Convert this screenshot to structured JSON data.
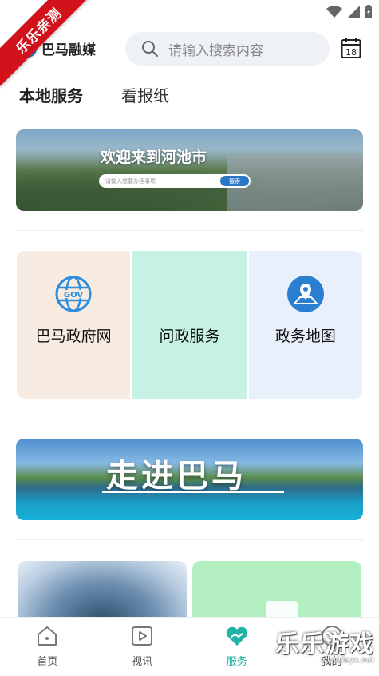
{
  "watermark": {
    "ribbon": "乐乐亲测",
    "logo": "乐乐游戏",
    "url": "www.leyx.net"
  },
  "header": {
    "brand_name": "巴马融媒",
    "search_placeholder": "请输入搜索内容",
    "calendar_day": "18"
  },
  "tabs": [
    {
      "label": "本地服务",
      "active": true
    },
    {
      "label": "看报纸",
      "active": false
    }
  ],
  "banner_welcome": {
    "title": "欢迎来到河池市",
    "search_placeholder": "请输入想要办理事项",
    "search_button": "搜索"
  },
  "services": [
    {
      "label": "巴马政府网",
      "icon": "gov-globe-icon",
      "color": "#f8ebe1"
    },
    {
      "label": "问政服务",
      "icon": "none",
      "color": "#c5f2e4"
    },
    {
      "label": "政务地图",
      "icon": "map-pin-icon",
      "color": "#e8f0fb"
    }
  ],
  "banner_bama": {
    "title": "走进巴马"
  },
  "nav": [
    {
      "label": "首页",
      "icon": "home-icon",
      "active": false
    },
    {
      "label": "视讯",
      "icon": "play-icon",
      "active": false
    },
    {
      "label": "服务",
      "icon": "heart-hand-icon",
      "active": true
    },
    {
      "label": "我的",
      "icon": "profile-icon",
      "active": false
    }
  ],
  "colors": {
    "accent": "#1fb3a6",
    "ribbon": "#d1121b",
    "gov_blue": "#2b8ee0"
  }
}
